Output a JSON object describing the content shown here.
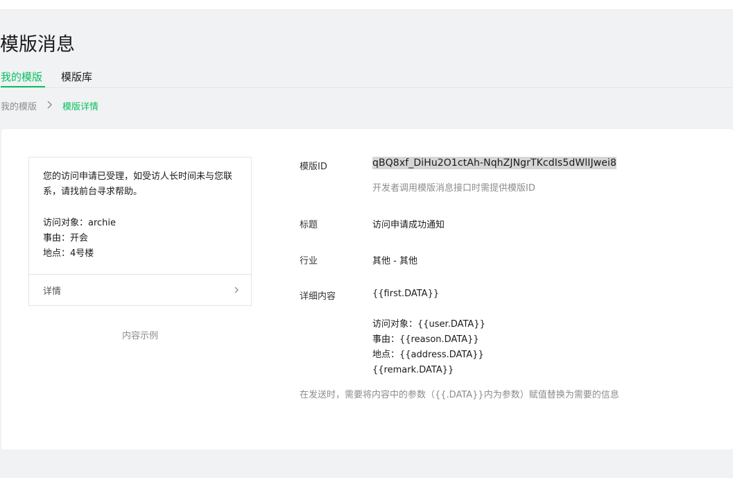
{
  "page": {
    "title": "模版消息"
  },
  "tabs": [
    {
      "label": "我的模版",
      "active": true
    },
    {
      "label": "模版库",
      "active": false
    }
  ],
  "breadcrumb": {
    "parent": "我的模版",
    "current": "模版详情"
  },
  "preview": {
    "message": "您的访问申请已受理，如受访人长时间未与您联系，请找前台寻求帮助。",
    "lines": [
      "访问对象：archie",
      "事由：开会",
      "地点：4号楼"
    ],
    "detail_label": "详情",
    "caption": "内容示例"
  },
  "fields": {
    "template_id": {
      "label": "模版ID",
      "value": "qBQ8xf_DiHu2O1ctAh-NqhZJNgrTKcdIs5dWlIJwei8",
      "hint": "开发者调用模版消息接口时需提供模版ID"
    },
    "title": {
      "label": "标题",
      "value": "访问申请成功通知"
    },
    "industry": {
      "label": "行业",
      "value": "其他 - 其他"
    },
    "content": {
      "label": "详细内容",
      "first": "{{first.DATA}}",
      "lines": [
        "访问对象：{{user.DATA}}",
        "事由：{{reason.DATA}}",
        "地点：{{address.DATA}}",
        "{{remark.DATA}}"
      ]
    }
  },
  "note": "在发送时，需要将内容中的参数（{{.DATA}}内为参数）赋值替换为需要的信息",
  "colors": {
    "accent": "#07c160",
    "background": "#f1f2f4",
    "card": "#ffffff",
    "muted": "#8c8c8c"
  }
}
